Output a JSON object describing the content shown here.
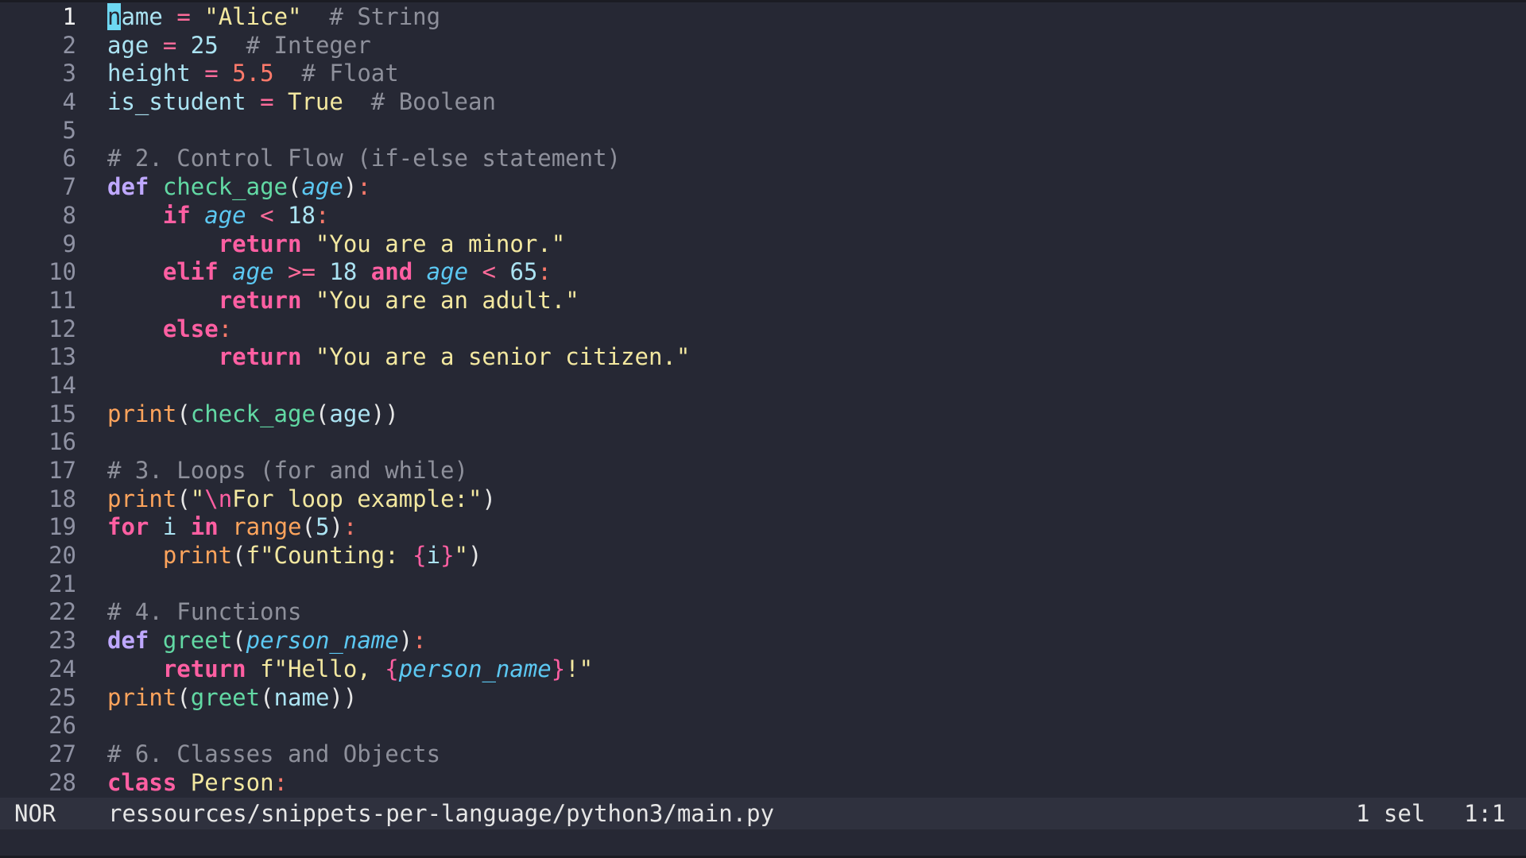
{
  "editor": {
    "lines": [
      {
        "n": "1",
        "tokens": [
          {
            "t": "n",
            "c": "cursor"
          },
          {
            "t": "ame",
            "c": "var"
          },
          {
            "t": " ",
            "c": "plain"
          },
          {
            "t": "=",
            "c": "op"
          },
          {
            "t": " ",
            "c": "plain"
          },
          {
            "t": "\"Alice\"",
            "c": "str"
          },
          {
            "t": "  ",
            "c": "plain"
          },
          {
            "t": "# String",
            "c": "cmt"
          }
        ]
      },
      {
        "n": "2",
        "tokens": [
          {
            "t": "age",
            "c": "var"
          },
          {
            "t": " ",
            "c": "plain"
          },
          {
            "t": "=",
            "c": "op"
          },
          {
            "t": " ",
            "c": "plain"
          },
          {
            "t": "25",
            "c": "num"
          },
          {
            "t": "  ",
            "c": "plain"
          },
          {
            "t": "# Integer",
            "c": "cmt"
          }
        ]
      },
      {
        "n": "3",
        "tokens": [
          {
            "t": "height",
            "c": "var"
          },
          {
            "t": " ",
            "c": "plain"
          },
          {
            "t": "=",
            "c": "op"
          },
          {
            "t": " ",
            "c": "plain"
          },
          {
            "t": "5.5",
            "c": "float"
          },
          {
            "t": "  ",
            "c": "plain"
          },
          {
            "t": "# Float",
            "c": "cmt"
          }
        ]
      },
      {
        "n": "4",
        "tokens": [
          {
            "t": "is_student",
            "c": "var"
          },
          {
            "t": " ",
            "c": "plain"
          },
          {
            "t": "=",
            "c": "op"
          },
          {
            "t": " ",
            "c": "plain"
          },
          {
            "t": "True",
            "c": "bool"
          },
          {
            "t": "  ",
            "c": "plain"
          },
          {
            "t": "# Boolean",
            "c": "cmt"
          }
        ]
      },
      {
        "n": "5",
        "tokens": []
      },
      {
        "n": "6",
        "tokens": [
          {
            "t": "# 2. Control Flow (if-else statement)",
            "c": "cmt"
          }
        ]
      },
      {
        "n": "7",
        "tokens": [
          {
            "t": "def",
            "c": "def"
          },
          {
            "t": " ",
            "c": "plain"
          },
          {
            "t": "check_age",
            "c": "fn"
          },
          {
            "t": "(",
            "c": "punc"
          },
          {
            "t": "age",
            "c": "param"
          },
          {
            "t": ")",
            "c": "punc"
          },
          {
            "t": ":",
            "c": "colon"
          }
        ]
      },
      {
        "n": "8",
        "tokens": [
          {
            "t": "    ",
            "c": "plain"
          },
          {
            "t": "if",
            "c": "kw"
          },
          {
            "t": " ",
            "c": "plain"
          },
          {
            "t": "age",
            "c": "param"
          },
          {
            "t": " ",
            "c": "plain"
          },
          {
            "t": "<",
            "c": "op"
          },
          {
            "t": " ",
            "c": "plain"
          },
          {
            "t": "18",
            "c": "num"
          },
          {
            "t": ":",
            "c": "colon"
          }
        ]
      },
      {
        "n": "9",
        "tokens": [
          {
            "t": "        ",
            "c": "plain"
          },
          {
            "t": "return",
            "c": "kw"
          },
          {
            "t": " ",
            "c": "plain"
          },
          {
            "t": "\"You are a minor.\"",
            "c": "str"
          }
        ]
      },
      {
        "n": "10",
        "tokens": [
          {
            "t": "    ",
            "c": "plain"
          },
          {
            "t": "elif",
            "c": "kw"
          },
          {
            "t": " ",
            "c": "plain"
          },
          {
            "t": "age",
            "c": "param"
          },
          {
            "t": " ",
            "c": "plain"
          },
          {
            "t": ">=",
            "c": "op"
          },
          {
            "t": " ",
            "c": "plain"
          },
          {
            "t": "18",
            "c": "num"
          },
          {
            "t": " ",
            "c": "plain"
          },
          {
            "t": "and",
            "c": "kw"
          },
          {
            "t": " ",
            "c": "plain"
          },
          {
            "t": "age",
            "c": "param"
          },
          {
            "t": " ",
            "c": "plain"
          },
          {
            "t": "<",
            "c": "op"
          },
          {
            "t": " ",
            "c": "plain"
          },
          {
            "t": "65",
            "c": "num"
          },
          {
            "t": ":",
            "c": "colon"
          }
        ]
      },
      {
        "n": "11",
        "tokens": [
          {
            "t": "        ",
            "c": "plain"
          },
          {
            "t": "return",
            "c": "kw"
          },
          {
            "t": " ",
            "c": "plain"
          },
          {
            "t": "\"You are an adult.\"",
            "c": "str"
          }
        ]
      },
      {
        "n": "12",
        "tokens": [
          {
            "t": "    ",
            "c": "plain"
          },
          {
            "t": "else",
            "c": "kw"
          },
          {
            "t": ":",
            "c": "colon"
          }
        ]
      },
      {
        "n": "13",
        "tokens": [
          {
            "t": "        ",
            "c": "plain"
          },
          {
            "t": "return",
            "c": "kw"
          },
          {
            "t": " ",
            "c": "plain"
          },
          {
            "t": "\"You are a senior citizen.\"",
            "c": "str"
          }
        ]
      },
      {
        "n": "14",
        "tokens": []
      },
      {
        "n": "15",
        "tokens": [
          {
            "t": "print",
            "c": "builtin"
          },
          {
            "t": "(",
            "c": "punc"
          },
          {
            "t": "check_age",
            "c": "fn"
          },
          {
            "t": "(",
            "c": "punc"
          },
          {
            "t": "age",
            "c": "var"
          },
          {
            "t": "))",
            "c": "punc"
          }
        ]
      },
      {
        "n": "16",
        "tokens": []
      },
      {
        "n": "17",
        "tokens": [
          {
            "t": "# 3. Loops (for and while)",
            "c": "cmt"
          }
        ]
      },
      {
        "n": "18",
        "tokens": [
          {
            "t": "print",
            "c": "builtin"
          },
          {
            "t": "(",
            "c": "punc"
          },
          {
            "t": "\"",
            "c": "str"
          },
          {
            "t": "\\n",
            "c": "esc"
          },
          {
            "t": "For loop example:\"",
            "c": "str"
          },
          {
            "t": ")",
            "c": "punc"
          }
        ]
      },
      {
        "n": "19",
        "tokens": [
          {
            "t": "for",
            "c": "kw"
          },
          {
            "t": " ",
            "c": "plain"
          },
          {
            "t": "i",
            "c": "var"
          },
          {
            "t": " ",
            "c": "plain"
          },
          {
            "t": "in",
            "c": "kw"
          },
          {
            "t": " ",
            "c": "plain"
          },
          {
            "t": "range",
            "c": "builtin"
          },
          {
            "t": "(",
            "c": "punc"
          },
          {
            "t": "5",
            "c": "num"
          },
          {
            "t": ")",
            "c": "punc"
          },
          {
            "t": ":",
            "c": "colon"
          }
        ]
      },
      {
        "n": "20",
        "tokens": [
          {
            "t": "    ",
            "c": "plain"
          },
          {
            "t": "print",
            "c": "builtin"
          },
          {
            "t": "(",
            "c": "punc"
          },
          {
            "t": "f\"Counting: ",
            "c": "str"
          },
          {
            "t": "{",
            "c": "brace"
          },
          {
            "t": "i",
            "c": "var"
          },
          {
            "t": "}",
            "c": "brace"
          },
          {
            "t": "\"",
            "c": "str"
          },
          {
            "t": ")",
            "c": "punc"
          }
        ]
      },
      {
        "n": "21",
        "tokens": []
      },
      {
        "n": "22",
        "tokens": [
          {
            "t": "# 4. Functions",
            "c": "cmt"
          }
        ]
      },
      {
        "n": "23",
        "tokens": [
          {
            "t": "def",
            "c": "def"
          },
          {
            "t": " ",
            "c": "plain"
          },
          {
            "t": "greet",
            "c": "fn"
          },
          {
            "t": "(",
            "c": "punc"
          },
          {
            "t": "person_name",
            "c": "param"
          },
          {
            "t": ")",
            "c": "punc"
          },
          {
            "t": ":",
            "c": "colon"
          }
        ]
      },
      {
        "n": "24",
        "tokens": [
          {
            "t": "    ",
            "c": "plain"
          },
          {
            "t": "return",
            "c": "kw"
          },
          {
            "t": " ",
            "c": "plain"
          },
          {
            "t": "f\"Hello, ",
            "c": "str"
          },
          {
            "t": "{",
            "c": "brace"
          },
          {
            "t": "person_name",
            "c": "param"
          },
          {
            "t": "}",
            "c": "brace"
          },
          {
            "t": "!\"",
            "c": "str"
          }
        ]
      },
      {
        "n": "25",
        "tokens": [
          {
            "t": "print",
            "c": "builtin"
          },
          {
            "t": "(",
            "c": "punc"
          },
          {
            "t": "greet",
            "c": "fn"
          },
          {
            "t": "(",
            "c": "punc"
          },
          {
            "t": "name",
            "c": "var"
          },
          {
            "t": "))",
            "c": "punc"
          }
        ]
      },
      {
        "n": "26",
        "tokens": []
      },
      {
        "n": "27",
        "tokens": [
          {
            "t": "# 6. Classes and Objects",
            "c": "cmt"
          }
        ]
      },
      {
        "n": "28",
        "tokens": [
          {
            "t": "class",
            "c": "kw"
          },
          {
            "t": " ",
            "c": "plain"
          },
          {
            "t": "Person",
            "c": "str"
          },
          {
            "t": ":",
            "c": "colon"
          }
        ]
      }
    ]
  },
  "statusbar": {
    "mode": "NOR",
    "file_path": "ressources/snippets-per-language/python3/main.py",
    "selections": "1 sel",
    "position": "1:1"
  },
  "colors": {
    "background": "#262834",
    "statusbar_bg": "#2f313e",
    "cursor": "#6ed8f2"
  }
}
